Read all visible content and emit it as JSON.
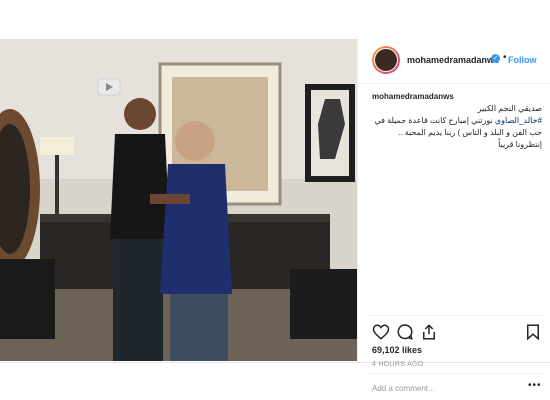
{
  "post": {
    "username": "mohamedramadanws",
    "follow_label": "Follow",
    "dot": "•",
    "verified_glyph": "✓",
    "caption_user": "mohamedramadanws",
    "caption_line1": "صديقي النجم الكبير",
    "caption_hashtag": "#خالد_الصاوي",
    "caption_rest": "نورتني إمبارح كانت قاعدة جميلة في حب الفن و البلد و الناس ) ربنا يديم المحبة .. إنتظرونا قريباً",
    "likes": "69,102 likes",
    "timestamp": "4 HOURS AGO",
    "comment_placeholder": "Add a comment...",
    "more_label": "•••"
  },
  "colors": {
    "accent": "#3897f0",
    "text": "#262626",
    "muted": "#999999"
  },
  "icons": [
    "heart-icon",
    "comment-icon",
    "share-icon",
    "bookmark-icon",
    "user-tag-icon"
  ]
}
